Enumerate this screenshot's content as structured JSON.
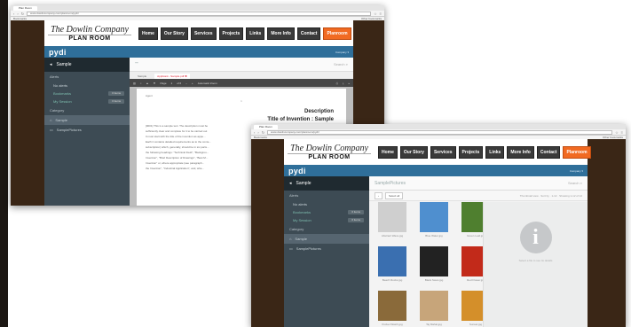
{
  "window1": {
    "tab_title": "Plan Room",
    "url": "www.dowlincompany.com/planroom/pydi/",
    "bookmarks": "Bookmarks",
    "other_bookmarks": "Other bookmarks",
    "logo": {
      "script": "The Dowlin Company",
      "subtitle": "PLAN ROOM"
    },
    "nav": [
      "Home",
      "Our Story",
      "Services",
      "Projects",
      "Links",
      "More Info",
      "Contact",
      "Planroom"
    ],
    "nav_active": "Planroom",
    "pydi_logo": "pydi",
    "user_menu": "Company ▾",
    "sidebar": {
      "header": "Sample",
      "section": "Alerts",
      "sub": "No alerts",
      "items": [
        {
          "label": "Bookmarks",
          "count": "0 items"
        },
        {
          "label": "My Session",
          "count": "0 items"
        }
      ],
      "categories_title": "Category",
      "categories": [
        "Sample",
        "SamplePictures"
      ]
    },
    "search_text": "\"\"",
    "search_placeholder": "Search",
    "doc_tabs": [
      "Sample",
      "Applicant - Sample.pdf ✖"
    ],
    "pdf_toolbar": {
      "page_label": "Page",
      "page_value": "1",
      "page_of": "of 6",
      "zoom": "Automatic Zoom"
    },
    "pdf": {
      "small": "Agent",
      "center": "1",
      "heading1": "Description",
      "heading2": "Title of Invention : Sample",
      "lines": [
        "[0001] This is a sample text. The description must be",
        "sufficiently clear and complete for it to be carried out",
        "It must start with the title of the invention as appe...",
        "Each it contains detailed requirements as to the conte...",
        "subscription) which, generally, should be in six parts...",
        "the following headings: \"Technical Field\", \"Backgrou...",
        "Invention\", \"Brief Description of Drawings\", \"Best M...",
        "Invention\" or, where appropriate (see paragraph...",
        "the Invention\", \"Industrial Application\", and, whe..."
      ]
    }
  },
  "window2": {
    "tab_title": "Plan Room",
    "url": "www.dowlincompany.com/planroom/pydi/",
    "bookmarks": "Bookmarks",
    "other_bookmarks": "Other bookmarks",
    "logo": {
      "script": "The Dowlin Company",
      "subtitle": "PLAN ROOM"
    },
    "nav": [
      "Home",
      "Our Story",
      "Services",
      "Projects",
      "Links",
      "More Info",
      "Contact",
      "Planroom"
    ],
    "nav_active": "Planroom",
    "pydi_logo": "pydi",
    "user_menu": "Company ▾",
    "sidebar": {
      "header": "Sample",
      "section": "Alerts",
      "sub": "No alerts",
      "items": [
        {
          "label": "Bookmarks",
          "count": "0 items"
        },
        {
          "label": "My Session",
          "count": "0 items"
        }
      ],
      "categories_title": "Category",
      "categories": [
        "Sample",
        "SamplePictures"
      ]
    },
    "search_text": "SamplePictures",
    "search_placeholder": "Search",
    "viewer": {
      "back_btn": "‹",
      "select_btn": "Select all",
      "status": "Thumbnail view · Sort by · 1-12 · Showing 1-12 of 12"
    },
    "thumbnails": [
      {
        "caption": "Abstract Wave.jpg",
        "color": "#cfcfcf"
      },
      {
        "caption": "Blue Water.jpg",
        "color": "#4f8fcf"
      },
      {
        "caption": "Green Leaf.jpg",
        "color": "#4f7f2f"
      },
      {
        "caption": "Beach Rocks.jpg",
        "color": "#3a6fb0"
      },
      {
        "caption": "Black Swan.jpg",
        "color": "#222222"
      },
      {
        "caption": "Red Flower.jpg",
        "color": "#c22a1a"
      },
      {
        "caption": "Pocket Watch.jpg",
        "color": "#8a6a3a"
      },
      {
        "caption": "Taj Mahal.jpg",
        "color": "#c7a57a"
      },
      {
        "caption": "Sunset.jpg",
        "color": "#d48f2a"
      }
    ],
    "info_icon": "i",
    "info_hint": "Select a file to see its details"
  }
}
